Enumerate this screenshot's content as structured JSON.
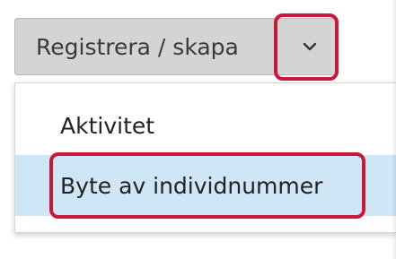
{
  "split_button": {
    "label": "Registrera / skapa",
    "toggle_icon": "chevron-down-icon"
  },
  "dropdown": {
    "items": [
      {
        "label": "Aktivitet",
        "selected": false
      },
      {
        "label": "Byte av individnummer",
        "selected": true
      }
    ]
  },
  "annotations": {
    "highlight_color": "#c8183d"
  },
  "colors": {
    "button_bg": "#d4d4d4",
    "selected_item_bg": "#cfe6f7",
    "text": "#222222"
  }
}
